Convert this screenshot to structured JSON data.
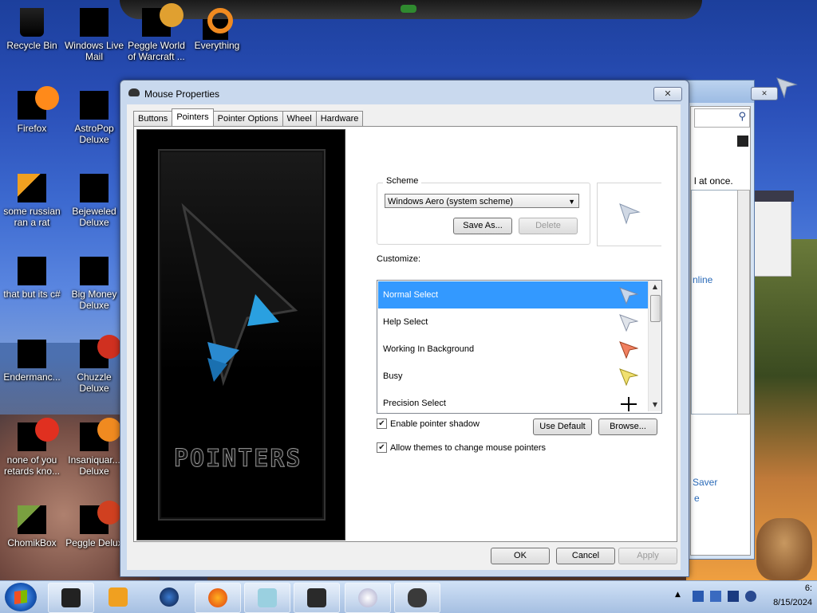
{
  "desktop": {
    "icons": [
      {
        "label": "Recycle Bin",
        "icon": "recycle-bin-icon"
      },
      {
        "label": "Windows Live Mail",
        "icon": "windows-live-mail-icon"
      },
      {
        "label": "Peggle World of Warcraft ...",
        "icon": "peggle-icon"
      },
      {
        "label": "Everything",
        "icon": "everything-search-icon"
      },
      {
        "label": "Firefox",
        "icon": "firefox-icon"
      },
      {
        "label": "AstroPop Deluxe",
        "icon": "astropop-icon"
      },
      {
        "label": "some russian ran a rat",
        "icon": "app-icon"
      },
      {
        "label": "Bejeweled Deluxe",
        "icon": "bejeweled-icon"
      },
      {
        "label": "that but its c#",
        "icon": "app-icon"
      },
      {
        "label": "Big Money Deluxe",
        "icon": "big-money-icon"
      },
      {
        "label": "Endermanc...",
        "icon": "app-icon"
      },
      {
        "label": "Chuzzle Deluxe",
        "icon": "chuzzle-icon"
      },
      {
        "label": "none of you retards kno...",
        "icon": "app-icon"
      },
      {
        "label": "Insaniquar... Deluxe",
        "icon": "insaniquarium-icon"
      },
      {
        "label": "ChomikBox",
        "icon": "chomikbox-icon"
      },
      {
        "label": "Peggle Delux",
        "icon": "peggle-icon"
      }
    ]
  },
  "background_window": {
    "fragment_text": "l at once.",
    "link_text": "nline",
    "link2_text": "Saver",
    "link3_text": "e",
    "minimize_glyph": "▭",
    "maximize_glyph": "▢",
    "close_glyph": "✕",
    "search_glyph": "⚲"
  },
  "dialog": {
    "title": "Mouse Properties",
    "close_glyph": "✕",
    "tabs": [
      "Buttons",
      "Pointers",
      "Pointer Options",
      "Wheel",
      "Hardware"
    ],
    "active_tab": "Pointers",
    "preview_text": "POINTERS",
    "scheme": {
      "label": "Scheme",
      "selected": "Windows Aero (system scheme)",
      "save_as": "Save As...",
      "delete": "Delete"
    },
    "customize_label": "Customize:",
    "cursors": [
      {
        "name": "Normal Select",
        "selected": true,
        "icon": "arrow-cursor-icon"
      },
      {
        "name": "Help Select",
        "selected": false,
        "icon": "help-cursor-icon"
      },
      {
        "name": "Working In Background",
        "selected": false,
        "icon": "working-cursor-icon"
      },
      {
        "name": "Busy",
        "selected": false,
        "icon": "busy-cursor-icon"
      },
      {
        "name": "Precision Select",
        "selected": false,
        "icon": "crosshair-cursor-icon"
      }
    ],
    "enable_shadow": {
      "label": "Enable pointer shadow",
      "checked": true
    },
    "allow_themes": {
      "label": "Allow themes to change mouse pointers",
      "checked": true
    },
    "use_default": "Use Default",
    "browse": "Browse...",
    "ok": "OK",
    "cancel": "Cancel",
    "apply": "Apply"
  },
  "taskbar": {
    "time": "6:",
    "date": "8/15/2024",
    "pinned": [
      "app",
      "media-player",
      "globe",
      "firefox",
      "explorer",
      "monitor",
      "ball",
      "mouse"
    ]
  },
  "colors": {
    "selection": "#3399ff",
    "dialog_frame": "#c9d9ee"
  }
}
